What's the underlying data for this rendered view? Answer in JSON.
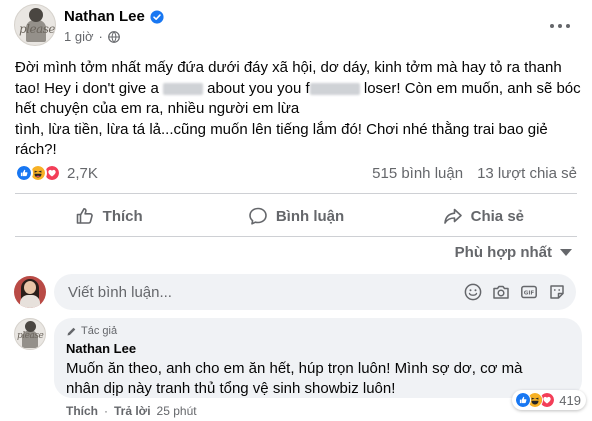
{
  "post": {
    "author": "Nathan Lee",
    "time": "1 giờ",
    "separator": "·",
    "text_lines": [
      [
        "Đời mình tởm nhất mấy đứa dưới đáy xã hội, dơ dáy, kinh tởm mà hay tỏ ra thanh"
      ],
      [
        "tao! Hey i don't give a ",
        " about you you f",
        " loser! Còn em muốn, anh sẽ bóc"
      ],
      [
        "hết chuyện của em ra, nhiều người em lừa"
      ],
      [
        "tình, lừa tiền, lừa tá lả...cũng muốn lên tiếng lắm đó! Chơi nhé thằng trai bao giẻ"
      ],
      [
        "rách?!"
      ]
    ],
    "reaction_count": "2,7K",
    "comments_count": "515 bình luận",
    "shares_count": "13 lượt chia sẻ"
  },
  "actions": {
    "like": "Thích",
    "comment": "Bình luận",
    "share": "Chia sẻ"
  },
  "sort_label": "Phù hợp nhất",
  "composer": {
    "placeholder": "Viết bình luận..."
  },
  "comment": {
    "badge": "Tác giả",
    "author": "Nathan Lee",
    "text_line1": "Muốn ăn theo, anh cho em ăn hết, húp trọn luôn! Mình sợ dơ, cơ mà",
    "text_line2": "nhân dịp này tranh thủ tổng vệ sinh showbiz luôn!",
    "reaction_count": "419",
    "like": "Thích",
    "reply": "Trả lời",
    "time": "25 phút"
  },
  "colors": {
    "facebook_blue": "#1877f2",
    "haha_yellow": "#f7b125",
    "love_red": "#f33e58",
    "secondary_text": "#65676b",
    "bubble_bg": "#f0f2f5"
  },
  "icons": [
    "verified-icon",
    "globe-icon",
    "more-icon",
    "like-icon",
    "haha-icon",
    "love-icon",
    "thumbs-up-icon",
    "comment-icon",
    "share-icon",
    "emoji-icon",
    "camera-icon",
    "gif-icon",
    "sticker-icon",
    "author-badge-icon"
  ]
}
